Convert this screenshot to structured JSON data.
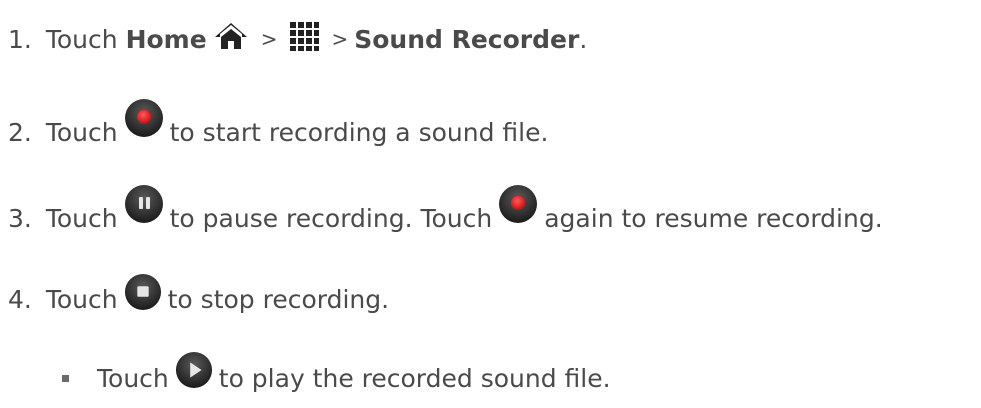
{
  "steps": [
    {
      "num": "1.",
      "prefix": "Touch",
      "home": "Home",
      "sep1": ">",
      "sep2": ">",
      "app": "Sound Recorder",
      "end": ".",
      "icons": [
        "home-icon",
        "apps-grid-icon"
      ]
    },
    {
      "num": "2.",
      "prefix": "Touch",
      "text": "to start recording a sound file.",
      "icons": [
        "record-icon"
      ]
    },
    {
      "num": "3.",
      "prefix": "Touch",
      "text1": "to pause recording. Touch",
      "text2": "again to resume recording.",
      "icons": [
        "pause-icon",
        "record-icon"
      ]
    },
    {
      "num": "4.",
      "prefix": "Touch",
      "text": "to stop recording.",
      "icons": [
        "stop-icon"
      ]
    }
  ],
  "bullet": {
    "prefix": "Touch",
    "text": "to play the recorded sound file.",
    "icons": [
      "play-icon"
    ]
  },
  "colors": {
    "text": "#4a4a4a",
    "record_red": "#e8222a",
    "button_dark": "#2a2a2a"
  }
}
